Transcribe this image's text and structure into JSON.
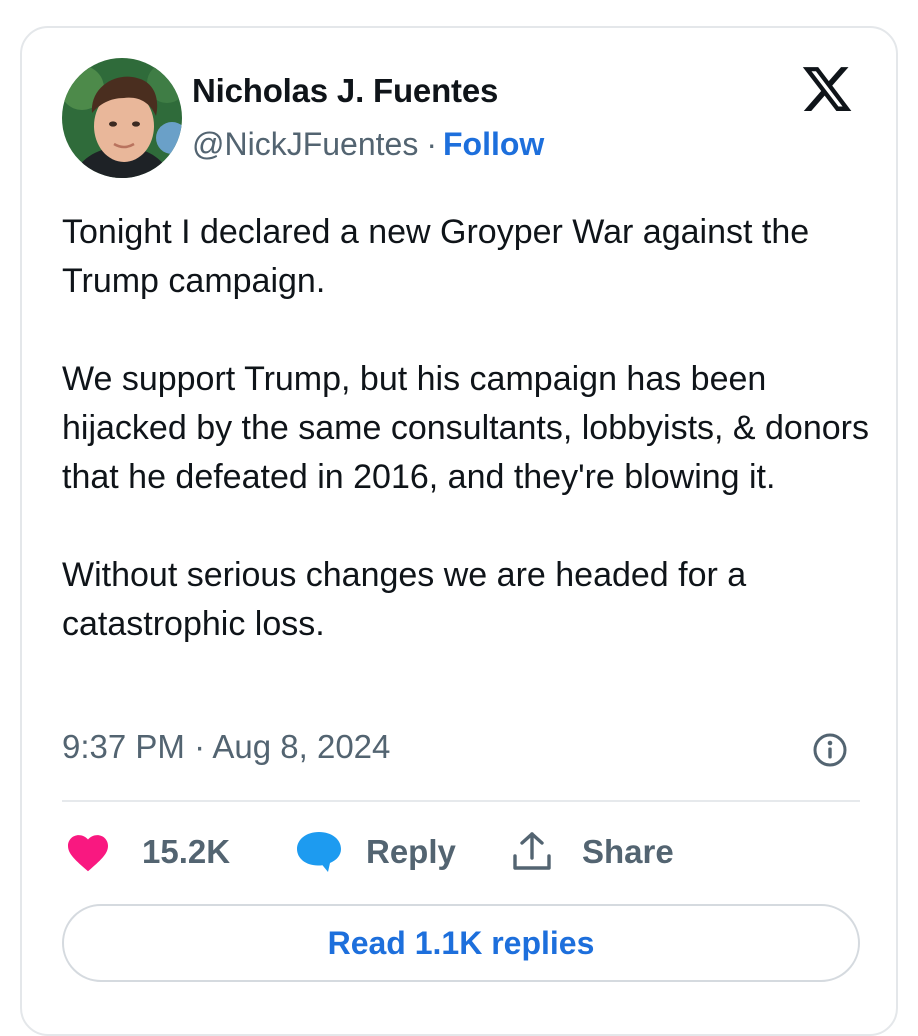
{
  "author": {
    "name": "Nicholas J. Fuentes",
    "handle": "@NickJFuentes",
    "separator": "·",
    "follow_label": "Follow"
  },
  "tweet": {
    "paragraphs": [
      "Tonight I declared a new Groyper War against the Trump campaign.",
      "We support Trump, but his campaign has been hijacked by the same consultants, lobbyists, & donors that he defeated in 2016, and they're blowing it.",
      "Without serious changes we are headed for a catastrophic loss."
    ],
    "timestamp": "9:37 PM · Aug 8, 2024"
  },
  "actions": {
    "like_count": "15.2K",
    "reply_label": "Reply",
    "share_label": "Share"
  },
  "read_replies_label": "Read 1.1K replies",
  "icons": {
    "platform": "x-logo-icon",
    "info": "info-icon",
    "like": "heart-icon",
    "reply": "speech-bubble-icon",
    "share": "share-upload-icon"
  },
  "colors": {
    "link_blue": "#1d6fdc",
    "heart_pink": "#f91880",
    "reply_blue": "#1d9bf0",
    "text_primary": "#0f1419",
    "text_secondary": "#536471"
  }
}
